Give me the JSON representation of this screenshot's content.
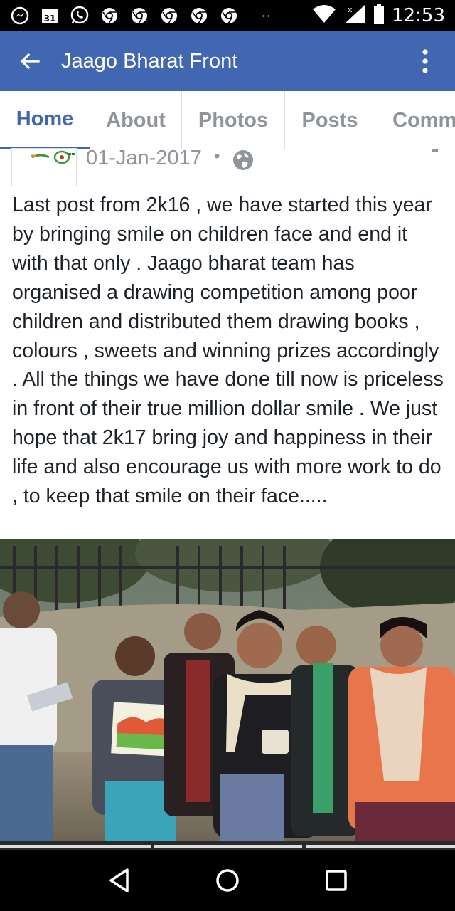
{
  "status_bar": {
    "time": "12:53",
    "calendar_day": "31",
    "icons": [
      "messenger-icon",
      "calendar-icon",
      "whatsapp-icon",
      "chrome-icon",
      "chrome-icon",
      "chrome-icon",
      "chrome-icon",
      "chrome-icon",
      "more-notifications-icon",
      "wifi-icon",
      "signal-icon",
      "battery-icon"
    ]
  },
  "app_bar": {
    "title": "Jaago Bharat Front",
    "color": "#4267b2"
  },
  "tabs": [
    {
      "label": "Home",
      "active": true
    },
    {
      "label": "About",
      "active": false
    },
    {
      "label": "Photos",
      "active": false
    },
    {
      "label": "Posts",
      "active": false
    },
    {
      "label": "Comm",
      "active": false
    }
  ],
  "post": {
    "date": "01-Jan-2017",
    "separator": "•",
    "privacy_icon": "globe-icon",
    "text": "Last post from 2k16 , we have started this year by bringing smile on children face and end it with that only . Jaago bharat team has organised a drawing competition among poor children  and distributed them drawing books , colours , sweets and winning prizes accordingly . All the things we have done till now is priceless in front of their true million dollar smile . We just hope that 2k17 bring joy and happiness in their life and also encourage us with more work to do , to keep that smile on their face....."
  },
  "nav_bar": {
    "buttons": [
      "back-triangle-icon",
      "home-circle-icon",
      "recents-square-icon"
    ]
  }
}
